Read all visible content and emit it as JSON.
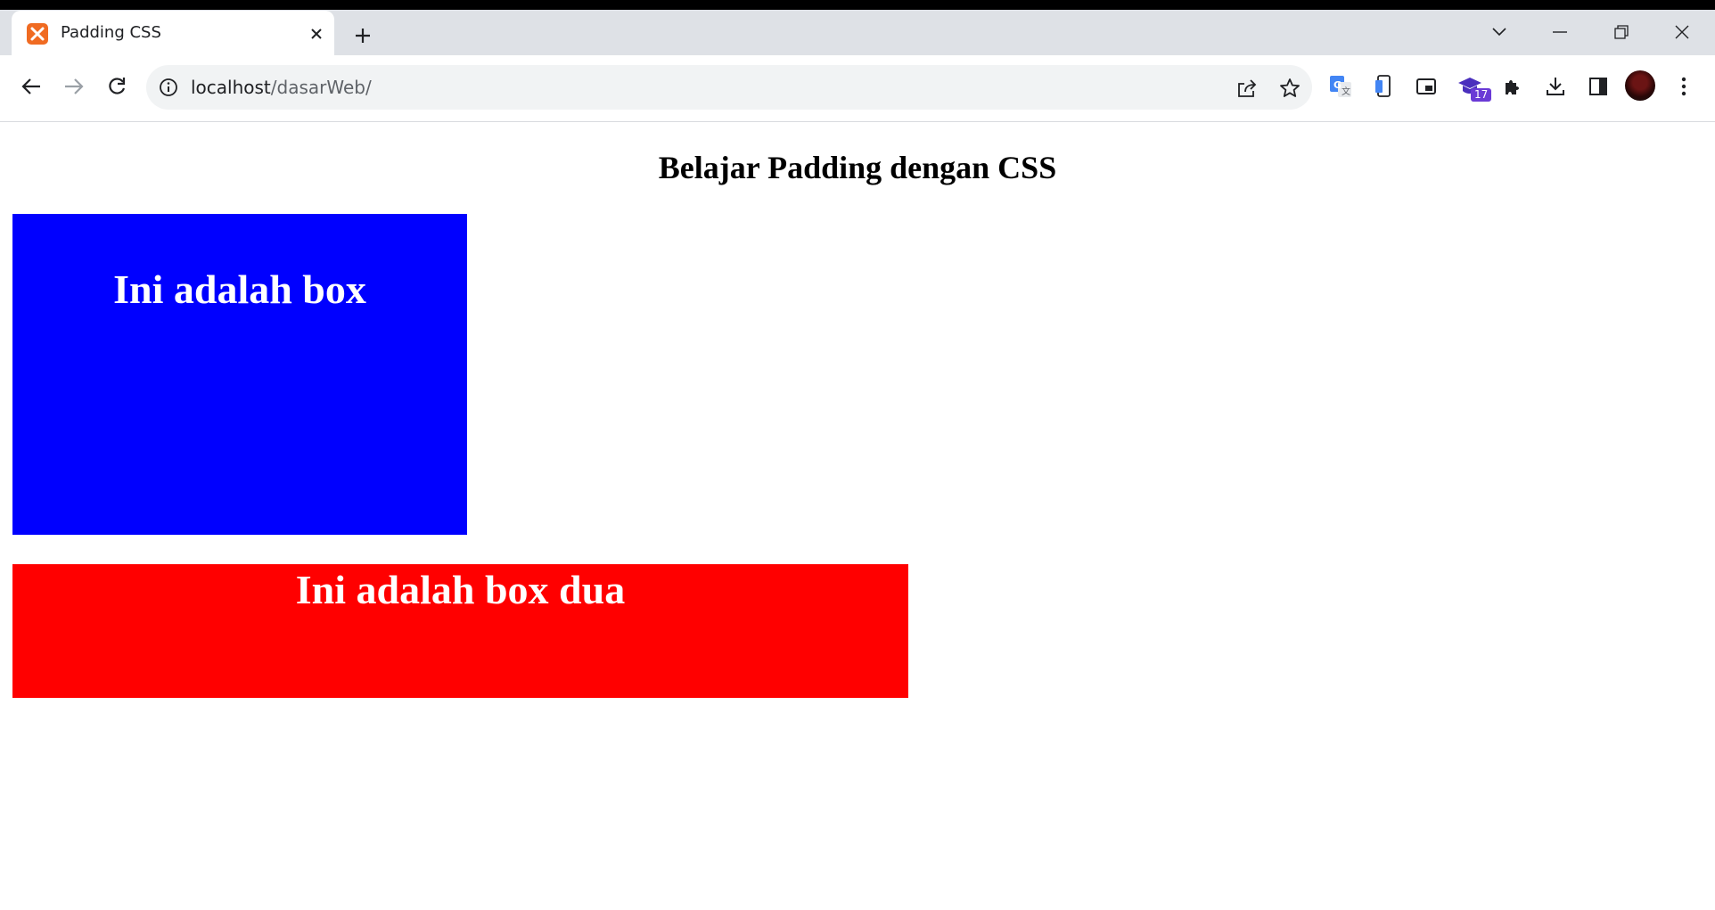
{
  "browser": {
    "tab": {
      "title": "Padding CSS",
      "favicon": "xampp-icon"
    },
    "address": {
      "host": "localhost",
      "path": "/dasarWeb/"
    },
    "extensions": {
      "badge_count": "17"
    }
  },
  "page": {
    "heading": "Belajar Padding dengan CSS",
    "box_one": {
      "text": "Ini adalah box",
      "color": "#0000ff"
    },
    "box_two": {
      "text": "Ini adalah box dua",
      "color": "#ff0000"
    }
  }
}
